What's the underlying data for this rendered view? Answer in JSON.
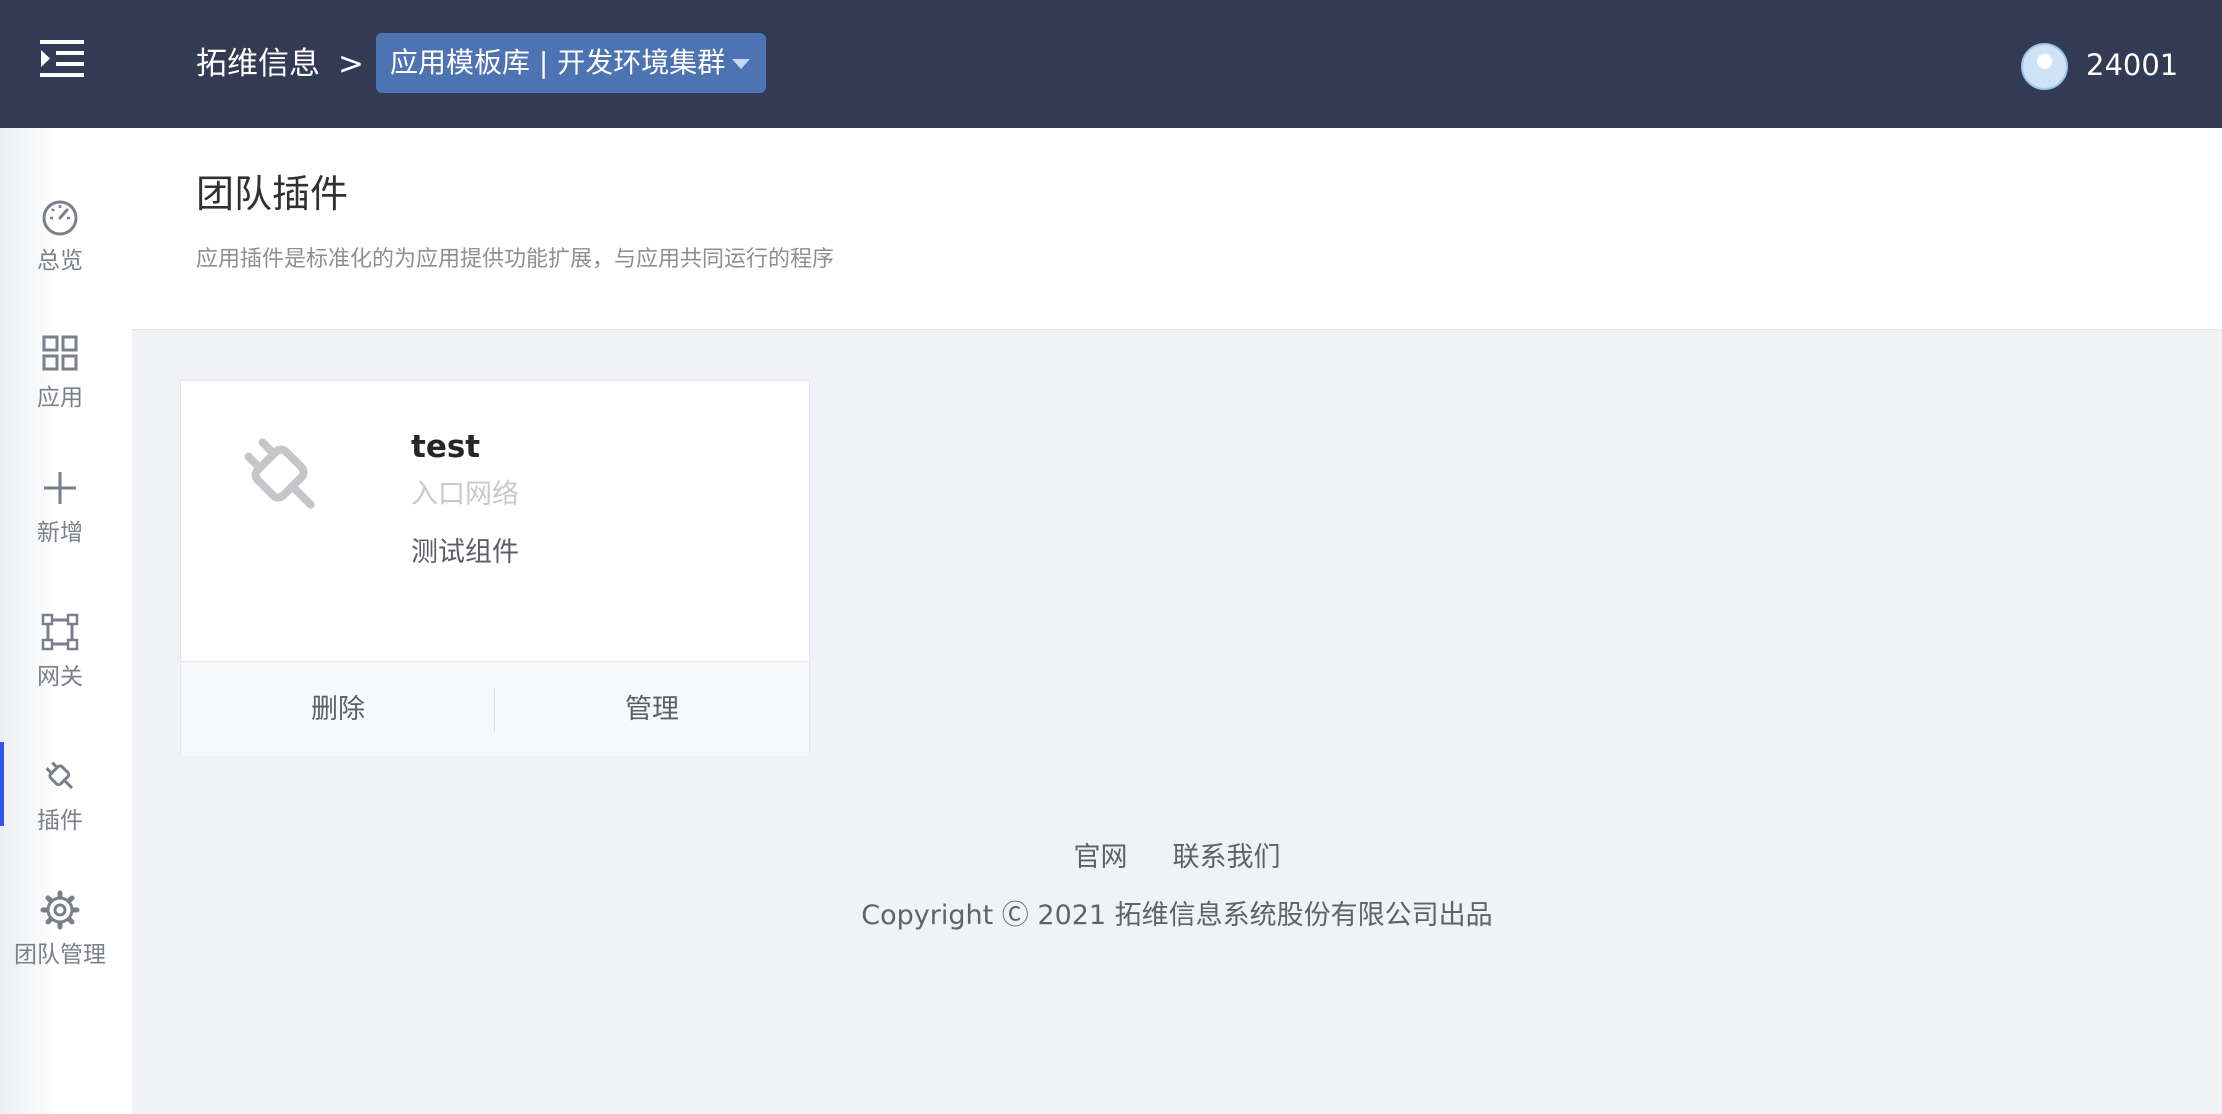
{
  "header": {
    "menu_icon": "menu-unfold-icon",
    "breadcrumb_root": "拓维信息",
    "breadcrumb_separator": ">",
    "team_env_select": "应用模板库 | 开发环境集群",
    "user_id": "24001"
  },
  "sidebar": {
    "items": [
      {
        "label": "总览",
        "icon": "dashboard-icon",
        "active": false
      },
      {
        "label": "应用",
        "icon": "apps-grid-icon",
        "active": false
      },
      {
        "label": "新增",
        "icon": "plus-icon",
        "active": false
      },
      {
        "label": "网关",
        "icon": "gateway-icon",
        "active": false
      },
      {
        "label": "插件",
        "icon": "plugin-icon",
        "active": true
      },
      {
        "label": "团队管理",
        "icon": "gear-icon",
        "active": false
      }
    ]
  },
  "page": {
    "title": "团队插件",
    "description": "应用插件是标准化的为应用提供功能扩展，与应用共同运行的程序"
  },
  "plugins": [
    {
      "name": "test",
      "category": "入口网络",
      "description": "测试组件",
      "icon": "plugin-icon",
      "actions": {
        "delete": "删除",
        "manage": "管理"
      }
    }
  ],
  "footer": {
    "links": [
      "官网",
      "联系我们"
    ],
    "copyright": "Copyright Ⓒ 2021 拓维信息系统股份有限公司出品"
  },
  "colors": {
    "header_bg": "#323a54",
    "accent": "#2f54eb",
    "select_bg": "#4d73b3",
    "content_bg": "#f0f2f5"
  }
}
